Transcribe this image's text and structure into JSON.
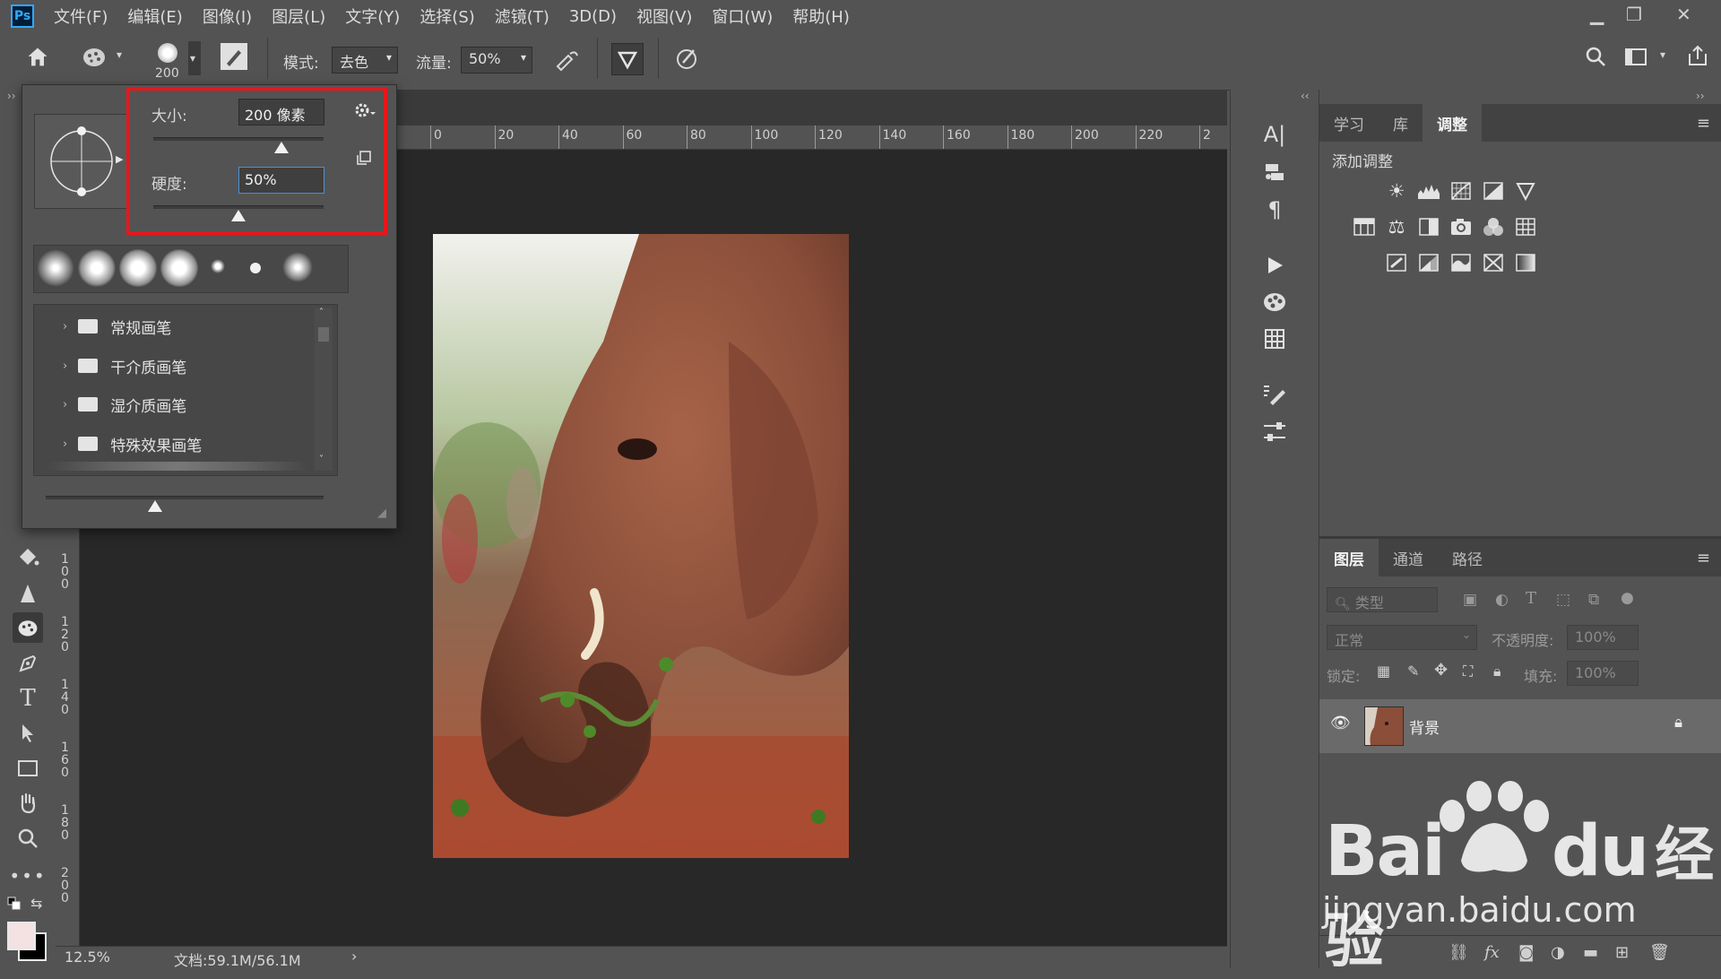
{
  "app": {
    "logo": "Ps"
  },
  "menubar": {
    "items": [
      "文件(F)",
      "编辑(E)",
      "图像(I)",
      "图层(L)",
      "文字(Y)",
      "选择(S)",
      "滤镜(T)",
      "3D(D)",
      "视图(V)",
      "窗口(W)",
      "帮助(H)"
    ],
    "window_controls": [
      "minimize-icon",
      "restore-icon",
      "close-icon"
    ]
  },
  "options": {
    "brush_size": "200",
    "mode_label": "模式:",
    "mode_value": "去色",
    "flow_label": "流量:",
    "flow_value": "50%"
  },
  "brush_popup": {
    "size_label": "大小:",
    "size_value": "200 像素",
    "size_slider_fraction": 0.75,
    "hardness_label": "硬度:",
    "hardness_value": "50%",
    "hardness_slider_fraction": 0.5,
    "folders": [
      "常规画笔",
      "干介质画笔",
      "湿介质画笔",
      "特殊效果画笔"
    ]
  },
  "ruler": {
    "h_ticks": [
      "0",
      "20",
      "40",
      "60",
      "80",
      "100",
      "120",
      "140",
      "160",
      "180",
      "200",
      "220",
      "2"
    ],
    "v_ticks": [
      "1",
      "0",
      "0",
      "1",
      "2",
      "0",
      "1",
      "4",
      "0",
      "1",
      "6",
      "0",
      "1",
      "8",
      "0",
      "2",
      "0",
      "0"
    ]
  },
  "status": {
    "zoom": "12.5%",
    "doc": "文档:59.1M/56.1M"
  },
  "adjustments": {
    "tabs": [
      "学习",
      "库",
      "调整"
    ],
    "active_tab": "调整",
    "add_label": "添加调整"
  },
  "layers": {
    "tabs": [
      "图层",
      "通道",
      "路径"
    ],
    "active_tab": "图层",
    "search_placeholder": "类型",
    "blend_mode": "正常",
    "opacity_label": "不透明度:",
    "opacity_value": "100%",
    "lock_label": "锁定:",
    "fill_label": "填充:",
    "fill_value": "100%",
    "items": [
      {
        "name": "背景",
        "visible": true,
        "locked": true
      }
    ]
  },
  "watermark": {
    "brand": "Bai",
    "brand2": "du",
    "cn": "经验",
    "url": "jingyan.baidu.com"
  },
  "colors": {
    "highlight": "#e6171c",
    "accent": "#31a8ff"
  }
}
